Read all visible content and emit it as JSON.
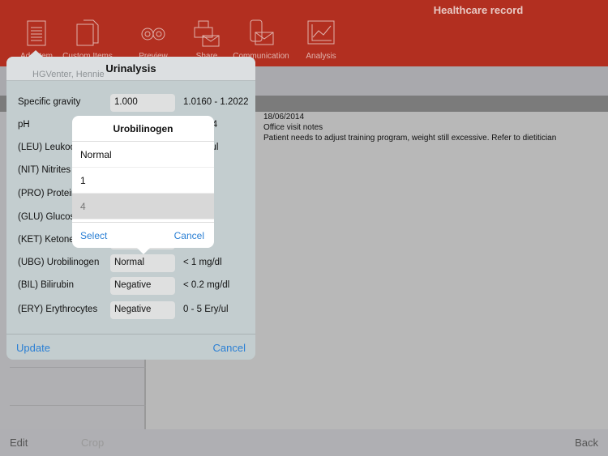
{
  "header": {
    "title": "Healthcare record",
    "tools": [
      {
        "label": "Add Item",
        "icon": "notepad-icon"
      },
      {
        "label": "Custom Items",
        "icon": "documents-icon"
      },
      {
        "label": "Preview",
        "icon": "binoculars-icon"
      },
      {
        "label": "Share",
        "icon": "print-mail-icon"
      },
      {
        "label": "Communication",
        "icon": "phone-mail-icon"
      },
      {
        "label": "Analysis",
        "icon": "chart-icon"
      }
    ]
  },
  "patient": {
    "name": "HGVenter, Hennie"
  },
  "note": {
    "date": "18/06/2014",
    "title": "Office visit notes",
    "text": "Patient needs to adjust training program, weight still excessive. Refer to dietitician"
  },
  "bottombar": {
    "edit": "Edit",
    "crop": "Crop",
    "back": "Back"
  },
  "urinalysis": {
    "title": "Urinalysis",
    "rows": [
      {
        "label": "Specific gravity",
        "value": "1.000",
        "range": "1.0160 - 1.2022"
      },
      {
        "label": "pH",
        "value": "",
        "range": "4.8 - 7.4"
      },
      {
        "label": "(LEU) Leukocytes",
        "value": "",
        "range": "Leuko/ul"
      },
      {
        "label": "(NIT) Nitrites",
        "value": "",
        "range": ""
      },
      {
        "label": "(PRO) Protein",
        "value": "",
        "range": "mg/dl"
      },
      {
        "label": "(GLU) Glucose",
        "value": "",
        "range": "mg/dl"
      },
      {
        "label": "(KET) Ketone",
        "value": "",
        "range": "mg/dl"
      },
      {
        "label": "(UBG) Urobilinogen",
        "value": "Normal",
        "range": "< 1 mg/dl"
      },
      {
        "label": "(BIL) Bilirubin",
        "value": "Negative",
        "range": "< 0.2 mg/dl"
      },
      {
        "label": "(ERY) Erythrocytes",
        "value": "Negative",
        "range": "0 - 5 Ery/ul"
      }
    ],
    "update": "Update",
    "cancel": "Cancel"
  },
  "picker": {
    "title": "Urobilinogen",
    "options": [
      "Normal",
      "1",
      "4"
    ],
    "selected": "4",
    "select": "Select",
    "cancel": "Cancel"
  },
  "colors": {
    "header": "#b22f20",
    "link": "#2a7fd4"
  }
}
